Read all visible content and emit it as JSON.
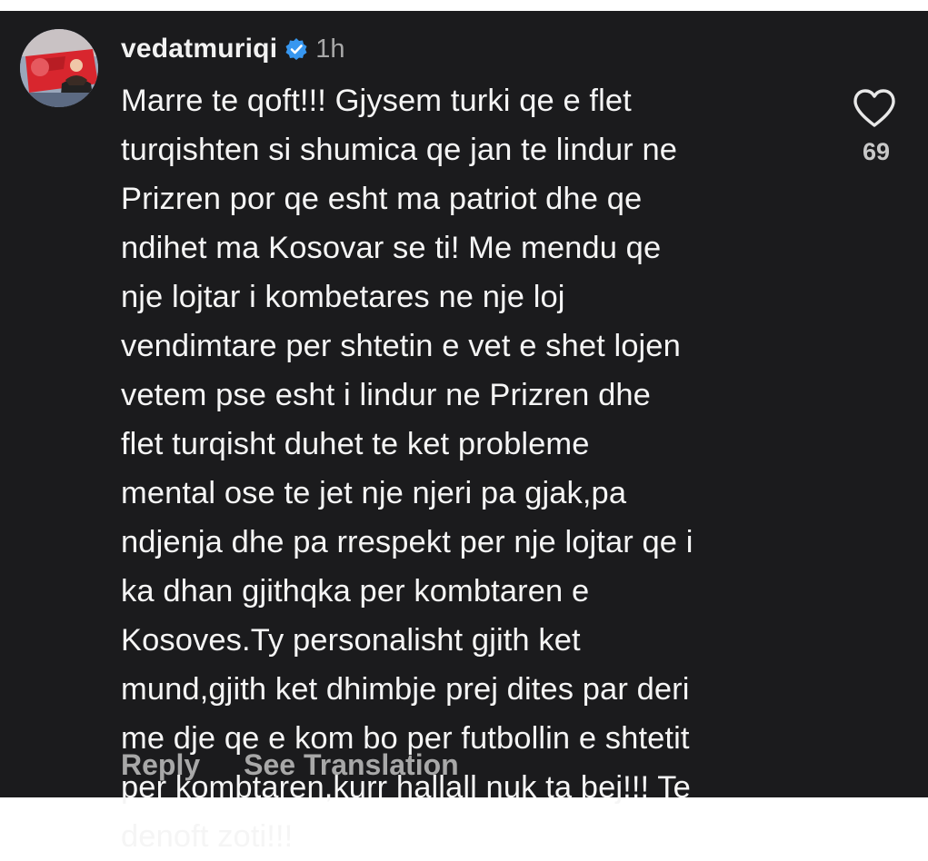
{
  "comment": {
    "username": "vedatmuriqi",
    "verified_icon": "verified-badge-icon",
    "time": "1h",
    "lines": [
      "Marre te qoft!!! Gjysem turki qe e flet",
      "turqishten si shumica qe jan te lindur ne",
      "Prizren por qe esht ma patriot dhe qe",
      "ndihet ma Kosovar se ti! Me mendu qe",
      "nje lojtar i kombetares ne nje loj",
      "vendimtare per shtetin e vet e shet lojen",
      "vetem pse esht i lindur ne Prizren dhe",
      "flet turqisht duhet te ket probleme",
      "mental ose te jet nje njeri pa gjak,pa",
      "ndjenja dhe pa rrespekt per nje lojtar qe i",
      "ka dhan gjithqka per kombtaren e",
      "Kosoves.Ty personalisht gjith ket",
      "mund,gjith ket dhimbje prej dites par deri",
      "me dje qe e kom bo per futbollin e shtetit",
      "per kombtaren,kurr hallall nuk ta bej!!! Te",
      "denoft zoti!!!"
    ],
    "like_icon": "heart-icon",
    "like_count": "69",
    "actions": {
      "reply": "Reply",
      "see_translation": "See Translation"
    }
  },
  "colors": {
    "background": "#1b1b1d",
    "text": "#f5f5f5",
    "muted": "#a8a8a8",
    "verified": "#3797f0"
  }
}
